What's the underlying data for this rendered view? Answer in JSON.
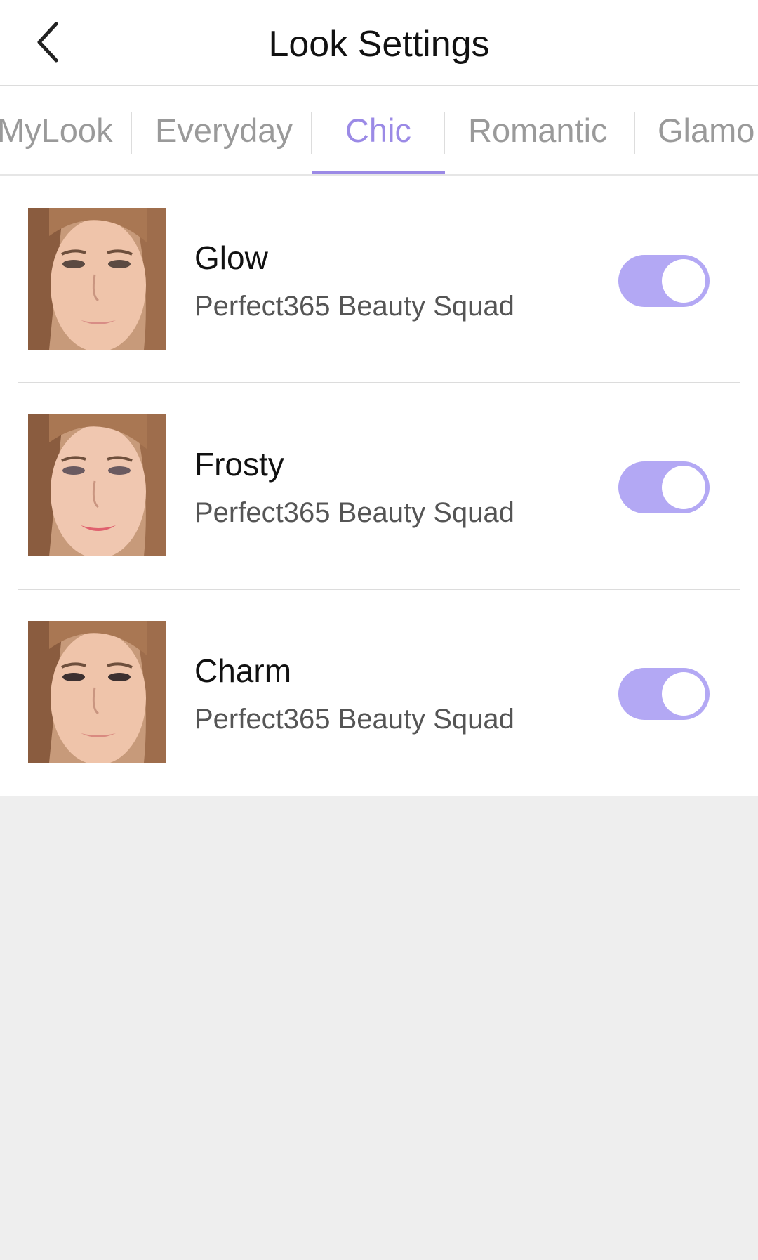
{
  "header": {
    "back_icon": "chevron-left-icon",
    "title": "Look Settings"
  },
  "tabs": [
    {
      "label": "MyLook",
      "active": false
    },
    {
      "label": "Everyday",
      "active": false
    },
    {
      "label": "Chic",
      "active": true
    },
    {
      "label": "Romantic",
      "active": false
    },
    {
      "label": "Glamo",
      "active": false
    }
  ],
  "looks": [
    {
      "name": "Glow",
      "author": "Perfect365 Beauty Squad",
      "enabled": true
    },
    {
      "name": "Frosty",
      "author": "Perfect365 Beauty Squad",
      "enabled": true
    },
    {
      "name": "Charm",
      "author": "Perfect365 Beauty Squad",
      "enabled": true
    }
  ],
  "colors": {
    "accent": "#9b8ae6",
    "toggle_on": "#b3a8f4",
    "background": "#eeeeee"
  }
}
